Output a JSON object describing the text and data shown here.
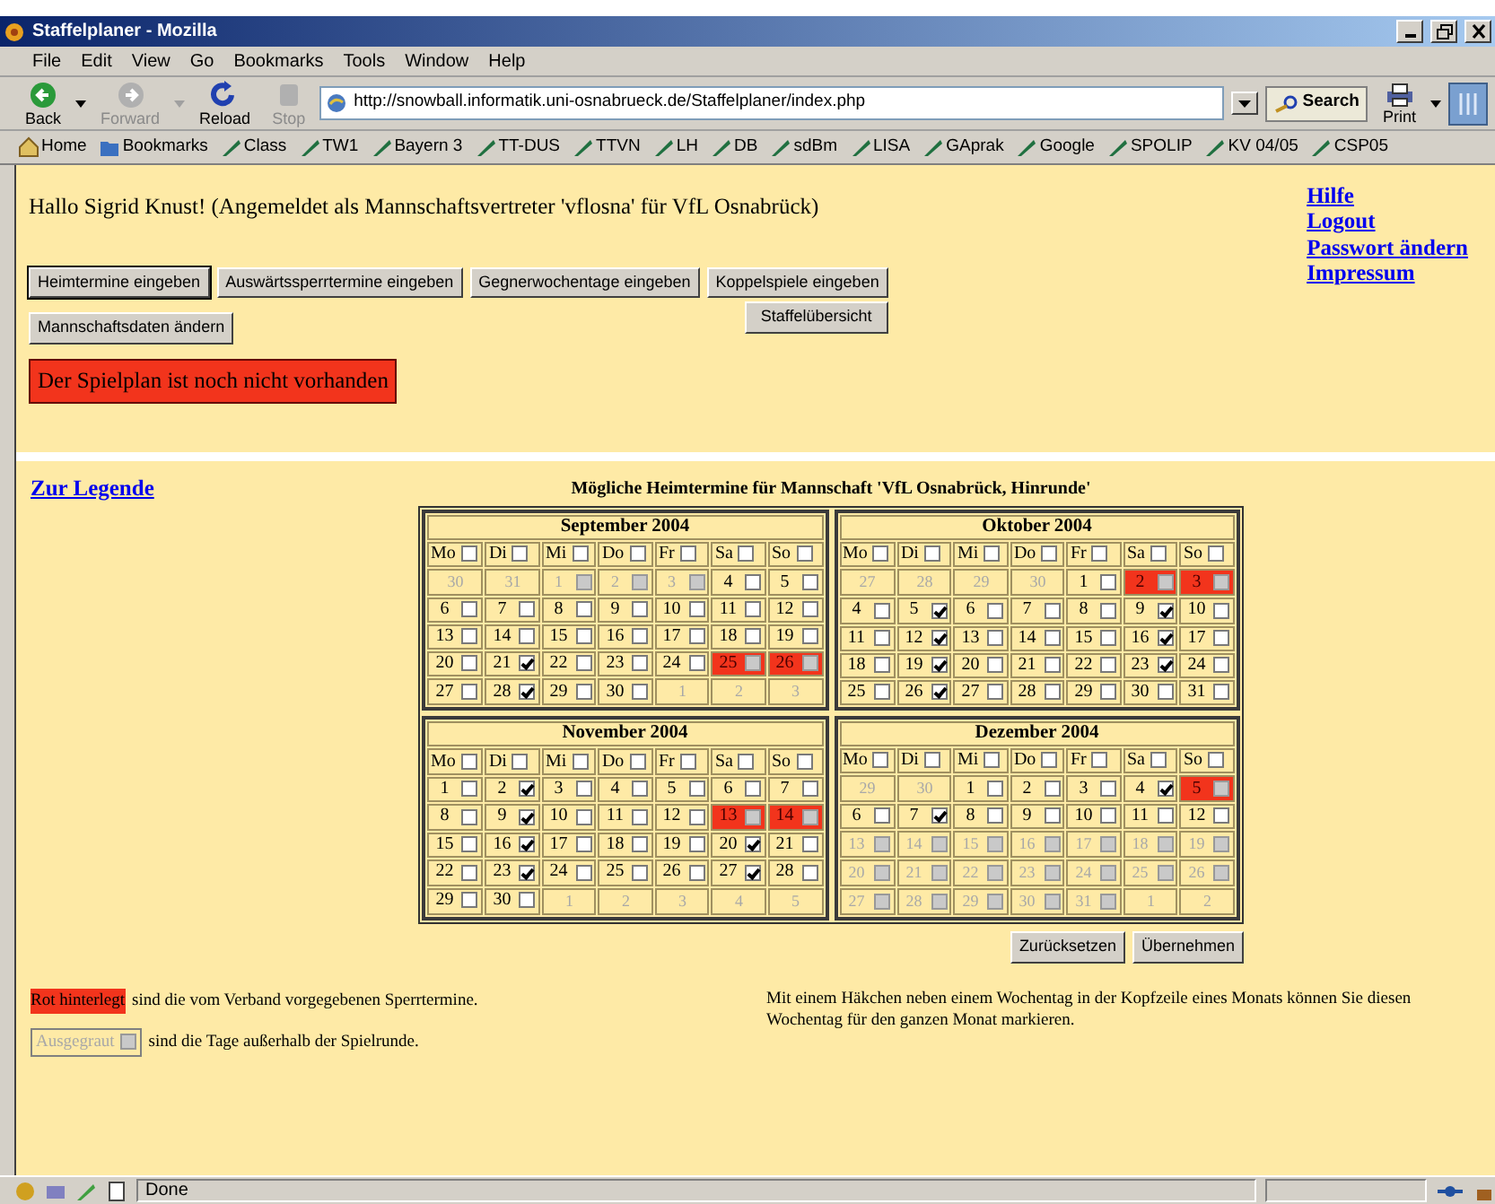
{
  "window": {
    "title": "Staffelplaner - Mozilla"
  },
  "menu": [
    "File",
    "Edit",
    "View",
    "Go",
    "Bookmarks",
    "Tools",
    "Window",
    "Help"
  ],
  "nav_buttons": [
    {
      "label": "Back",
      "kind": "back",
      "disabled": false
    },
    {
      "label": "Forward",
      "kind": "forward",
      "disabled": true
    },
    {
      "label": "Reload",
      "kind": "reload",
      "disabled": false
    },
    {
      "label": "Stop",
      "kind": "stop",
      "disabled": true
    }
  ],
  "address": "http://snowball.informatik.uni-osnabrueck.de/Staffelplaner/index.php",
  "search_button": "Search",
  "print_button": "Print",
  "bookmarks": [
    {
      "label": "Home",
      "kind": "home"
    },
    {
      "label": "Bookmarks",
      "kind": "folder"
    },
    {
      "label": "Class",
      "kind": "link"
    },
    {
      "label": "TW1",
      "kind": "link"
    },
    {
      "label": "Bayern 3",
      "kind": "link"
    },
    {
      "label": "TT-DUS",
      "kind": "link"
    },
    {
      "label": "TTVN",
      "kind": "link"
    },
    {
      "label": "LH",
      "kind": "link"
    },
    {
      "label": "DB",
      "kind": "link"
    },
    {
      "label": "sdBm",
      "kind": "link"
    },
    {
      "label": "LISA",
      "kind": "link"
    },
    {
      "label": "GAprak",
      "kind": "link"
    },
    {
      "label": "Google",
      "kind": "link"
    },
    {
      "label": "SPOLIP",
      "kind": "link"
    },
    {
      "label": "KV 04/05",
      "kind": "link"
    },
    {
      "label": "CSP05",
      "kind": "link"
    }
  ],
  "page": {
    "greeting": "Hallo Sigrid Knust! (Angemeldet als Mannschaftsvertreter 'vflosna' für VfL Osnabrück)",
    "links": [
      "Hilfe",
      "Logout",
      "Passwort ändern",
      "Impressum"
    ],
    "buttons": [
      {
        "label": "Heimtermine eingeben",
        "selected": true
      },
      {
        "label": "Auswärtssperrtermine eingeben",
        "selected": false
      },
      {
        "label": "Gegnerwochentage eingeben",
        "selected": false
      },
      {
        "label": "Koppelspiele eingeben",
        "selected": false
      },
      {
        "label": "Mannschaftsdaten ändern",
        "selected": false
      },
      {
        "label": "Staffelübersicht",
        "selected": false
      }
    ],
    "notice": "Der Spielplan ist noch nicht vorhanden",
    "legend_link": "Zur Legende",
    "calendar_title": "Mögliche Heimtermine für Mannschaft 'VfL Osnabrück, Hinrunde'",
    "months": [
      {
        "title": "September 2004",
        "weekdays": [
          {
            "label": "Mo",
            "checked": false
          },
          {
            "label": "Di",
            "checked": false
          },
          {
            "label": "Mi",
            "checked": false
          },
          {
            "label": "Do",
            "checked": false
          },
          {
            "label": "Fr",
            "checked": false
          },
          {
            "label": "Sa",
            "checked": false
          },
          {
            "label": "So",
            "checked": false
          }
        ],
        "weeks": [
          [
            {
              "day": "30",
              "kind": "other"
            },
            {
              "day": "31",
              "kind": "other"
            },
            {
              "day": "1",
              "kind": "outside",
              "checked": false
            },
            {
              "day": "2",
              "kind": "outside",
              "checked": false
            },
            {
              "day": "3",
              "kind": "outside",
              "checked": false
            },
            {
              "day": "4",
              "kind": "normal",
              "checked": false
            },
            {
              "day": "5",
              "kind": "normal",
              "checked": false
            }
          ],
          [
            {
              "day": "6",
              "kind": "normal",
              "checked": false
            },
            {
              "day": "7",
              "kind": "normal",
              "checked": false
            },
            {
              "day": "8",
              "kind": "normal",
              "checked": false
            },
            {
              "day": "9",
              "kind": "normal",
              "checked": false
            },
            {
              "day": "10",
              "kind": "normal",
              "checked": false
            },
            {
              "day": "11",
              "kind": "normal",
              "checked": false
            },
            {
              "day": "12",
              "kind": "normal",
              "checked": false
            }
          ],
          [
            {
              "day": "13",
              "kind": "normal",
              "checked": false
            },
            {
              "day": "14",
              "kind": "normal",
              "checked": false
            },
            {
              "day": "15",
              "kind": "normal",
              "checked": false
            },
            {
              "day": "16",
              "kind": "normal",
              "checked": false
            },
            {
              "day": "17",
              "kind": "normal",
              "checked": false
            },
            {
              "day": "18",
              "kind": "normal",
              "checked": false
            },
            {
              "day": "19",
              "kind": "normal",
              "checked": false
            }
          ],
          [
            {
              "day": "20",
              "kind": "normal",
              "checked": false
            },
            {
              "day": "21",
              "kind": "normal",
              "checked": true
            },
            {
              "day": "22",
              "kind": "normal",
              "checked": false
            },
            {
              "day": "23",
              "kind": "normal",
              "checked": false
            },
            {
              "day": "24",
              "kind": "normal",
              "checked": false
            },
            {
              "day": "25",
              "kind": "blocked",
              "checked": false
            },
            {
              "day": "26",
              "kind": "blocked",
              "checked": false
            }
          ],
          [
            {
              "day": "27",
              "kind": "normal",
              "checked": false
            },
            {
              "day": "28",
              "kind": "normal",
              "checked": true
            },
            {
              "day": "29",
              "kind": "normal",
              "checked": false
            },
            {
              "day": "30",
              "kind": "normal",
              "checked": false
            },
            {
              "day": "1",
              "kind": "other"
            },
            {
              "day": "2",
              "kind": "other"
            },
            {
              "day": "3",
              "kind": "other"
            }
          ]
        ]
      },
      {
        "title": "Oktober 2004",
        "weekdays": [
          {
            "label": "Mo",
            "checked": false
          },
          {
            "label": "Di",
            "checked": false
          },
          {
            "label": "Mi",
            "checked": false
          },
          {
            "label": "Do",
            "checked": false
          },
          {
            "label": "Fr",
            "checked": false
          },
          {
            "label": "Sa",
            "checked": false
          },
          {
            "label": "So",
            "checked": false
          }
        ],
        "weeks": [
          [
            {
              "day": "27",
              "kind": "other"
            },
            {
              "day": "28",
              "kind": "other"
            },
            {
              "day": "29",
              "kind": "other"
            },
            {
              "day": "30",
              "kind": "other"
            },
            {
              "day": "1",
              "kind": "normal",
              "checked": false
            },
            {
              "day": "2",
              "kind": "blocked",
              "checked": false
            },
            {
              "day": "3",
              "kind": "blocked",
              "checked": false
            }
          ],
          [
            {
              "day": "4",
              "kind": "normal",
              "checked": false
            },
            {
              "day": "5",
              "kind": "normal",
              "checked": true
            },
            {
              "day": "6",
              "kind": "normal",
              "checked": false
            },
            {
              "day": "7",
              "kind": "normal",
              "checked": false
            },
            {
              "day": "8",
              "kind": "normal",
              "checked": false
            },
            {
              "day": "9",
              "kind": "normal",
              "checked": true
            },
            {
              "day": "10",
              "kind": "normal",
              "checked": false
            }
          ],
          [
            {
              "day": "11",
              "kind": "normal",
              "checked": false
            },
            {
              "day": "12",
              "kind": "normal",
              "checked": true
            },
            {
              "day": "13",
              "kind": "normal",
              "checked": false
            },
            {
              "day": "14",
              "kind": "normal",
              "checked": false
            },
            {
              "day": "15",
              "kind": "normal",
              "checked": false
            },
            {
              "day": "16",
              "kind": "normal",
              "checked": true
            },
            {
              "day": "17",
              "kind": "normal",
              "checked": false
            }
          ],
          [
            {
              "day": "18",
              "kind": "normal",
              "checked": false
            },
            {
              "day": "19",
              "kind": "normal",
              "checked": true
            },
            {
              "day": "20",
              "kind": "normal",
              "checked": false
            },
            {
              "day": "21",
              "kind": "normal",
              "checked": false
            },
            {
              "day": "22",
              "kind": "normal",
              "checked": false
            },
            {
              "day": "23",
              "kind": "normal",
              "checked": true
            },
            {
              "day": "24",
              "kind": "normal",
              "checked": false
            }
          ],
          [
            {
              "day": "25",
              "kind": "normal",
              "checked": false
            },
            {
              "day": "26",
              "kind": "normal",
              "checked": true
            },
            {
              "day": "27",
              "kind": "normal",
              "checked": false
            },
            {
              "day": "28",
              "kind": "normal",
              "checked": false
            },
            {
              "day": "29",
              "kind": "normal",
              "checked": false
            },
            {
              "day": "30",
              "kind": "normal",
              "checked": false
            },
            {
              "day": "31",
              "kind": "normal",
              "checked": false
            }
          ]
        ]
      },
      {
        "title": "November 2004",
        "weekdays": [
          {
            "label": "Mo",
            "checked": false
          },
          {
            "label": "Di",
            "checked": false
          },
          {
            "label": "Mi",
            "checked": false
          },
          {
            "label": "Do",
            "checked": false
          },
          {
            "label": "Fr",
            "checked": false
          },
          {
            "label": "Sa",
            "checked": false
          },
          {
            "label": "So",
            "checked": false
          }
        ],
        "weeks": [
          [
            {
              "day": "1",
              "kind": "normal",
              "checked": false
            },
            {
              "day": "2",
              "kind": "normal",
              "checked": true
            },
            {
              "day": "3",
              "kind": "normal",
              "checked": false
            },
            {
              "day": "4",
              "kind": "normal",
              "checked": false
            },
            {
              "day": "5",
              "kind": "normal",
              "checked": false
            },
            {
              "day": "6",
              "kind": "normal",
              "checked": false
            },
            {
              "day": "7",
              "kind": "normal",
              "checked": false
            }
          ],
          [
            {
              "day": "8",
              "kind": "normal",
              "checked": false
            },
            {
              "day": "9",
              "kind": "normal",
              "checked": true
            },
            {
              "day": "10",
              "kind": "normal",
              "checked": false
            },
            {
              "day": "11",
              "kind": "normal",
              "checked": false
            },
            {
              "day": "12",
              "kind": "normal",
              "checked": false
            },
            {
              "day": "13",
              "kind": "blocked",
              "checked": false
            },
            {
              "day": "14",
              "kind": "blocked",
              "checked": false
            }
          ],
          [
            {
              "day": "15",
              "kind": "normal",
              "checked": false
            },
            {
              "day": "16",
              "kind": "normal",
              "checked": true
            },
            {
              "day": "17",
              "kind": "normal",
              "checked": false
            },
            {
              "day": "18",
              "kind": "normal",
              "checked": false
            },
            {
              "day": "19",
              "kind": "normal",
              "checked": false
            },
            {
              "day": "20",
              "kind": "normal",
              "checked": true
            },
            {
              "day": "21",
              "kind": "normal",
              "checked": false
            }
          ],
          [
            {
              "day": "22",
              "kind": "normal",
              "checked": false
            },
            {
              "day": "23",
              "kind": "normal",
              "checked": true
            },
            {
              "day": "24",
              "kind": "normal",
              "checked": false
            },
            {
              "day": "25",
              "kind": "normal",
              "checked": false
            },
            {
              "day": "26",
              "kind": "normal",
              "checked": false
            },
            {
              "day": "27",
              "kind": "normal",
              "checked": true
            },
            {
              "day": "28",
              "kind": "normal",
              "checked": false
            }
          ],
          [
            {
              "day": "29",
              "kind": "normal",
              "checked": false
            },
            {
              "day": "30",
              "kind": "normal",
              "checked": false
            },
            {
              "day": "1",
              "kind": "other"
            },
            {
              "day": "2",
              "kind": "other"
            },
            {
              "day": "3",
              "kind": "other"
            },
            {
              "day": "4",
              "kind": "other"
            },
            {
              "day": "5",
              "kind": "other"
            }
          ]
        ]
      },
      {
        "title": "Dezember 2004",
        "weekdays": [
          {
            "label": "Mo",
            "checked": false
          },
          {
            "label": "Di",
            "checked": false
          },
          {
            "label": "Mi",
            "checked": false
          },
          {
            "label": "Do",
            "checked": false
          },
          {
            "label": "Fr",
            "checked": false
          },
          {
            "label": "Sa",
            "checked": false
          },
          {
            "label": "So",
            "checked": false
          }
        ],
        "weeks": [
          [
            {
              "day": "29",
              "kind": "other"
            },
            {
              "day": "30",
              "kind": "other"
            },
            {
              "day": "1",
              "kind": "normal",
              "checked": false
            },
            {
              "day": "2",
              "kind": "normal",
              "checked": false
            },
            {
              "day": "3",
              "kind": "normal",
              "checked": false
            },
            {
              "day": "4",
              "kind": "normal",
              "checked": true
            },
            {
              "day": "5",
              "kind": "blocked",
              "checked": false
            }
          ],
          [
            {
              "day": "6",
              "kind": "normal",
              "checked": false
            },
            {
              "day": "7",
              "kind": "normal",
              "checked": true
            },
            {
              "day": "8",
              "kind": "normal",
              "checked": false
            },
            {
              "day": "9",
              "kind": "normal",
              "checked": false
            },
            {
              "day": "10",
              "kind": "normal",
              "checked": false
            },
            {
              "day": "11",
              "kind": "normal",
              "checked": false
            },
            {
              "day": "12",
              "kind": "normal",
              "checked": false
            }
          ],
          [
            {
              "day": "13",
              "kind": "outside",
              "checked": false
            },
            {
              "day": "14",
              "kind": "outside",
              "checked": false
            },
            {
              "day": "15",
              "kind": "outside",
              "checked": false
            },
            {
              "day": "16",
              "kind": "outside",
              "checked": false
            },
            {
              "day": "17",
              "kind": "outside",
              "checked": false
            },
            {
              "day": "18",
              "kind": "outside",
              "checked": false
            },
            {
              "day": "19",
              "kind": "outside",
              "checked": false
            }
          ],
          [
            {
              "day": "20",
              "kind": "outside",
              "checked": false
            },
            {
              "day": "21",
              "kind": "outside",
              "checked": false
            },
            {
              "day": "22",
              "kind": "outside",
              "checked": false
            },
            {
              "day": "23",
              "kind": "outside",
              "checked": false
            },
            {
              "day": "24",
              "kind": "outside",
              "checked": false
            },
            {
              "day": "25",
              "kind": "outside",
              "checked": false
            },
            {
              "day": "26",
              "kind": "outside",
              "checked": false
            }
          ],
          [
            {
              "day": "27",
              "kind": "outside",
              "checked": false
            },
            {
              "day": "28",
              "kind": "outside",
              "checked": false
            },
            {
              "day": "29",
              "kind": "outside",
              "checked": false
            },
            {
              "day": "30",
              "kind": "outside",
              "checked": false
            },
            {
              "day": "31",
              "kind": "outside",
              "checked": false
            },
            {
              "day": "1",
              "kind": "other"
            },
            {
              "day": "2",
              "kind": "other"
            }
          ]
        ]
      }
    ],
    "reset_button": "Zurücksetzen",
    "apply_button": "Übernehmen",
    "legend": [
      {
        "kind": "blocked",
        "sample": "Rot hinterlegt",
        "text": "sind die vom Verband vorgegebenen Sperrtermine."
      },
      {
        "kind": "outside",
        "sample": "Ausgegraut",
        "text": "sind die Tage außerhalb der Spielrunde.",
        "checked": false
      }
    ],
    "hint": "Mit einem Häkchen neben einem Wochentag in der Kopfzeile eines Monats können Sie diesen Wochentag für den ganzen Monat markieren."
  },
  "status_bar": {
    "text": "Done"
  }
}
